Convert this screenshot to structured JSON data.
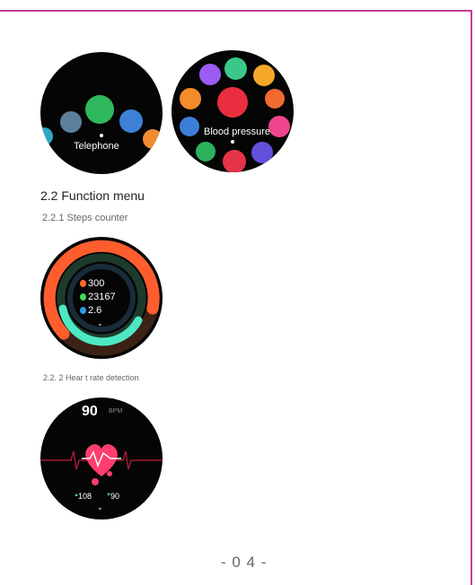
{
  "watch1": {
    "label": "Telephone"
  },
  "watch2": {
    "label": "Blood pressure"
  },
  "section": {
    "title": "2.2 Function menu",
    "sub1": "2.2.1 Steps counter",
    "sub2": "2.2. 2 Hear  t rate detection"
  },
  "steps": {
    "calories": "300",
    "steps": "23167",
    "distance": "2.6"
  },
  "heart": {
    "bpm": "90",
    "unit": "BPM",
    "max": "108",
    "min": "90"
  },
  "page_number": "- 0 4 -",
  "colors": {
    "border": "#c33d98",
    "heart": "#ff3d6e"
  }
}
